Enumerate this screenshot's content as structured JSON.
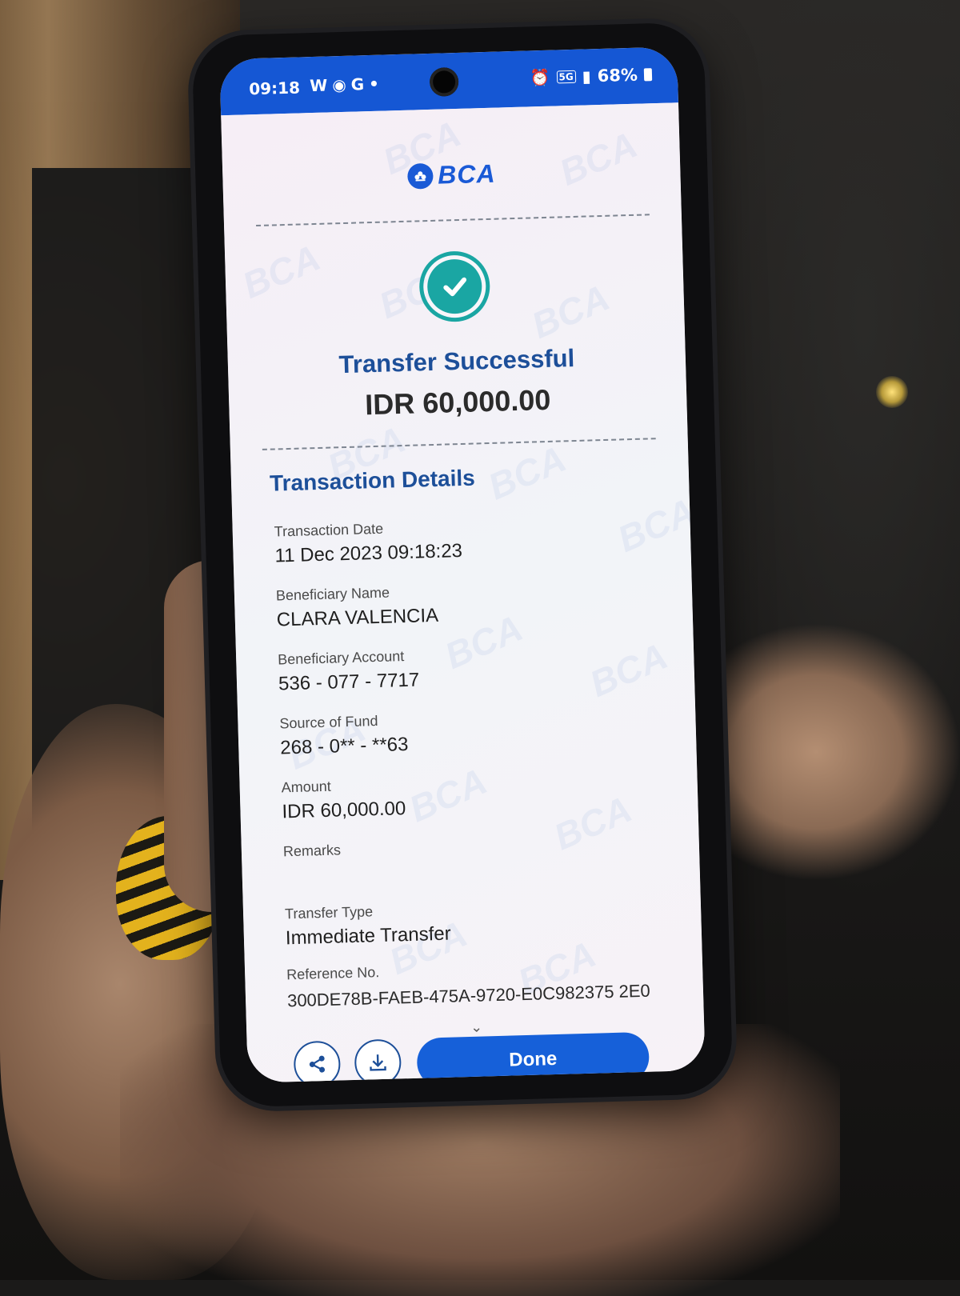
{
  "status_bar": {
    "time": "09:18",
    "left_icons": [
      "W",
      "G",
      "•"
    ],
    "network": "5G",
    "battery": "68%"
  },
  "brand": {
    "name": "BCA",
    "color": "#1a5ad6"
  },
  "result": {
    "title": "Transfer Successful",
    "amount": "IDR 60,000.00",
    "status_color": "#1aa6a3"
  },
  "details": {
    "section_title": "Transaction Details",
    "transaction_date_label": "Transaction Date",
    "transaction_date": "11 Dec 2023 09:18:23",
    "beneficiary_name_label": "Beneficiary Name",
    "beneficiary_name": "CLARA VALENCIA",
    "beneficiary_account_label": "Beneficiary Account",
    "beneficiary_account": "536 - 077 - 7717",
    "source_of_fund_label": "Source of Fund",
    "source_of_fund": "268 - 0** - **63",
    "amount_label": "Amount",
    "amount": "IDR 60,000.00",
    "remarks_label": "Remarks",
    "remarks": "",
    "transfer_type_label": "Transfer Type",
    "transfer_type": "Immediate Transfer",
    "reference_no_label": "Reference No.",
    "reference_no": "300DE78B-FAEB-475A-9720-E0C982375 2E0"
  },
  "actions": {
    "share_icon": "share-icon",
    "download_icon": "download-icon",
    "done_label": "Done",
    "accent": "#1660d9"
  },
  "watermark_text": "BCA"
}
